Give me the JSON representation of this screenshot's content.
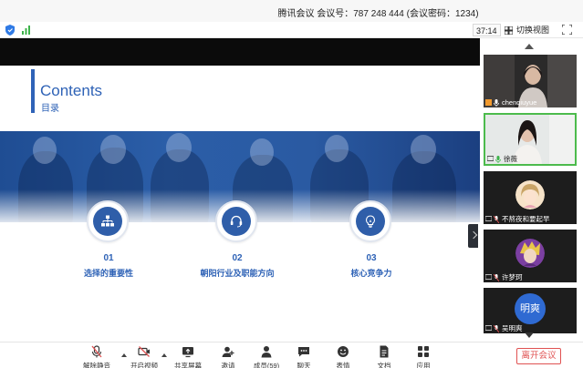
{
  "window": {
    "title": "腾讯会议  会议号：787 248 444  (会议密码：1234)"
  },
  "status": {
    "timer": "37:14",
    "switch_view_label": "切换视图"
  },
  "slide": {
    "title_en": "Contents",
    "title_cn": "目录",
    "items": [
      {
        "num": "01",
        "label": "选择的重要性",
        "icon": "org-chart-icon"
      },
      {
        "num": "02",
        "label": "朝阳行业及职能方向",
        "icon": "headset-icon"
      },
      {
        "num": "03",
        "label": "核心竞争力",
        "icon": "lightbulb-icon"
      }
    ],
    "accent_color": "#2e62b6"
  },
  "participants": [
    {
      "name": "chenqiuyue",
      "speaking": false
    },
    {
      "name": "徐薇",
      "speaking": true
    },
    {
      "name": "不熬夜和要起早",
      "speaking": false
    },
    {
      "name": "许梦珂",
      "speaking": false
    },
    {
      "name": "吴明爽",
      "avatar_text": "明爽",
      "speaking": false
    }
  ],
  "toolbar": {
    "unmute": "解除静音",
    "start_video": "开启视频",
    "share_screen": "共享屏幕",
    "invite": "邀请",
    "members": "成员(59)",
    "chat": "聊天",
    "reactions": "表情",
    "documents": "文档",
    "apps": "应用",
    "leave": "离开会议"
  },
  "colors": {
    "leave": "#e05252",
    "active_speaker": "#4cbb4c",
    "banner": "#2b5ea8"
  }
}
